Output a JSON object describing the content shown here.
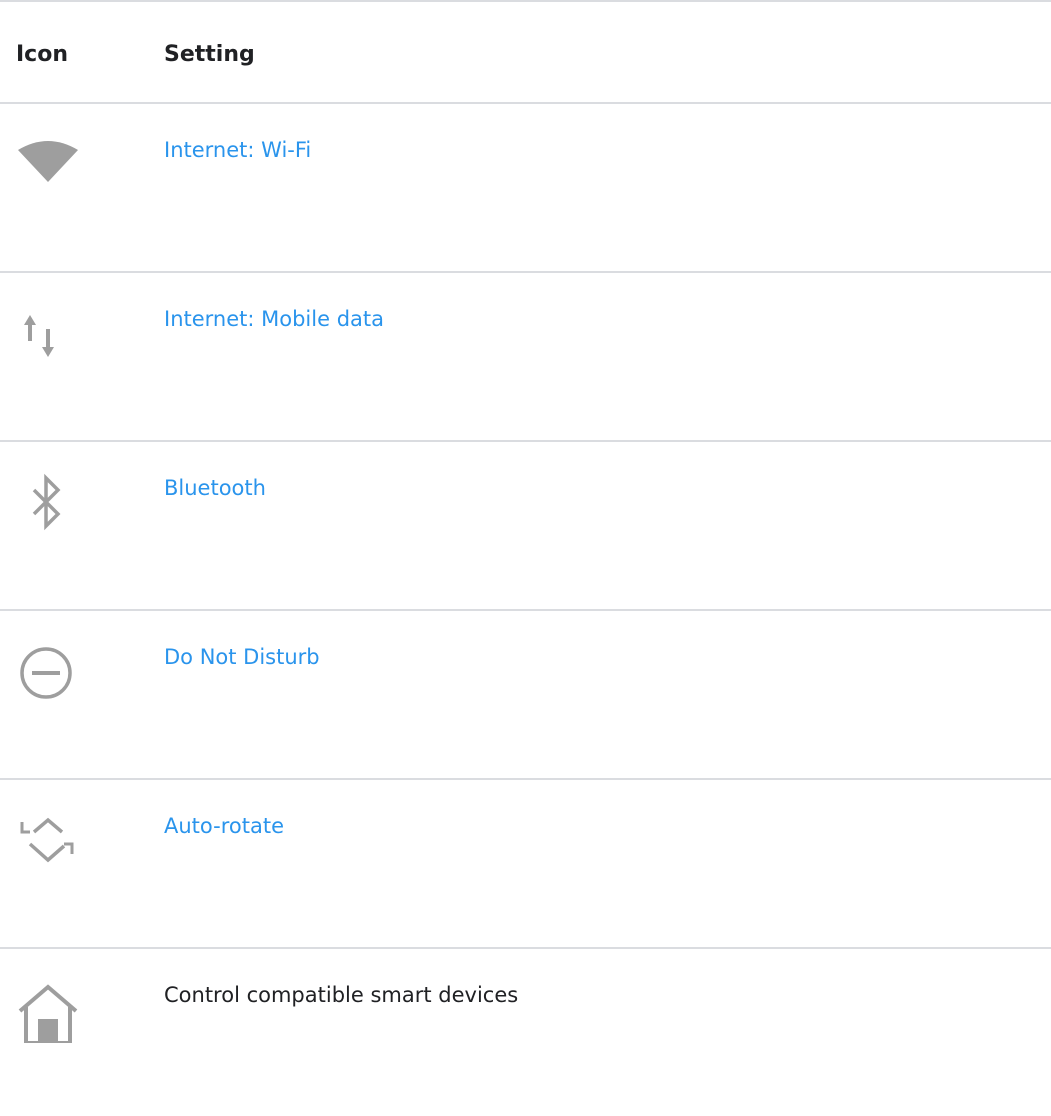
{
  "table": {
    "headers": {
      "icon": "Icon",
      "setting": "Setting"
    },
    "rows": [
      {
        "icon": "wifi-icon",
        "label": "Internet: Wi-Fi",
        "is_link": true
      },
      {
        "icon": "mobile-data-icon",
        "label": "Internet: Mobile data",
        "is_link": true
      },
      {
        "icon": "bluetooth-icon",
        "label": "Bluetooth",
        "is_link": true
      },
      {
        "icon": "do-not-disturb-icon",
        "label": "Do Not Disturb",
        "is_link": true
      },
      {
        "icon": "auto-rotate-icon",
        "label": "Auto-rotate",
        "is_link": true
      },
      {
        "icon": "home-icon",
        "label": "Control compatible smart devices",
        "is_link": false
      }
    ]
  },
  "colors": {
    "link": "#2a94ec",
    "text": "#202124",
    "icon": "#9e9e9e",
    "divider": "#dadce0"
  }
}
